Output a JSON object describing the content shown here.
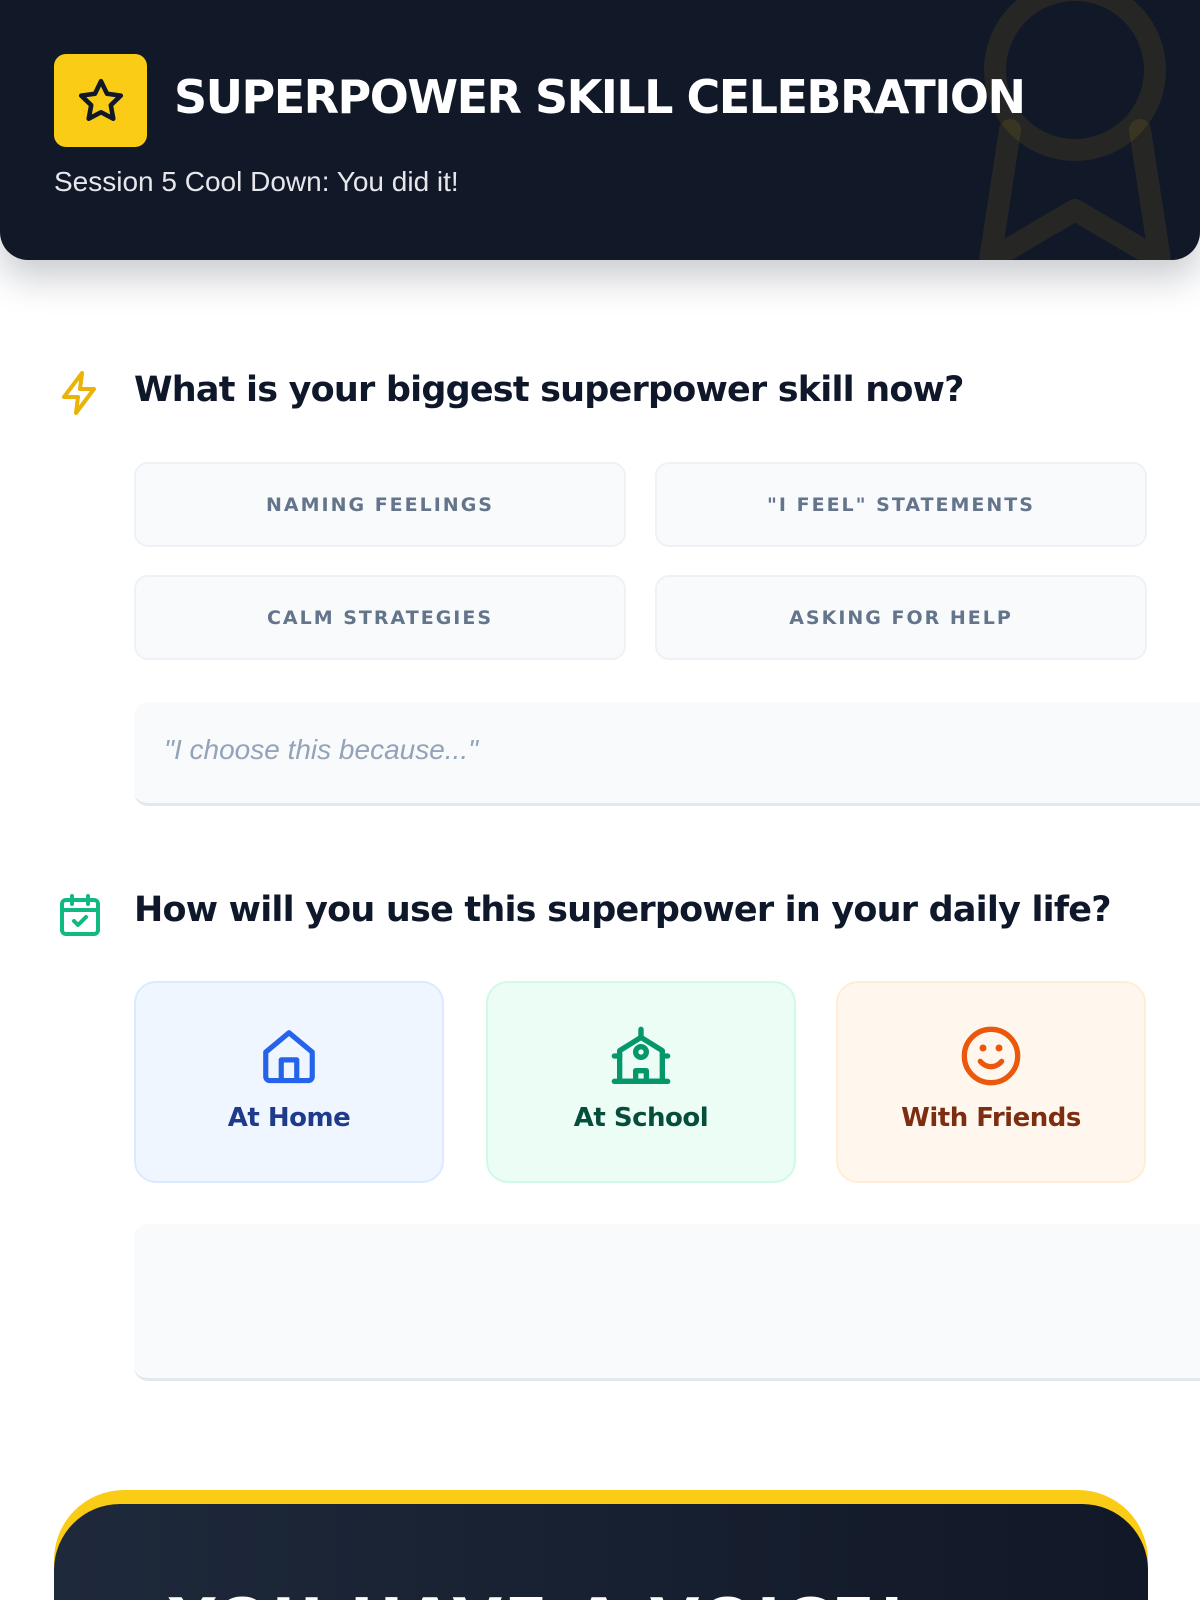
{
  "header": {
    "title": "SUPERPOWER SKILL CELEBRATION",
    "subtitle": "Session 5 Cool Down: You did it!",
    "icon": "star-icon",
    "decoration_icon": "award-ribbon-icon"
  },
  "question1": {
    "icon": "lightning-bolt-icon",
    "title": "What is your biggest superpower skill now?",
    "options": [
      "NAMING FEELINGS",
      "\"I FEEL\" STATEMENTS",
      "CALM STRATEGIES",
      "ASKING FOR HELP"
    ],
    "reason_placeholder": "\"I choose this because...\""
  },
  "question2": {
    "icon": "calendar-check-icon",
    "title": "How will you use this superpower in your daily life?",
    "cards": [
      {
        "label": "At Home",
        "icon": "house-icon",
        "color": "#2563eb",
        "text_color": "#1e3a8a"
      },
      {
        "label": "At School",
        "icon": "school-icon",
        "color": "#059669",
        "text_color": "#064e3b"
      },
      {
        "label": "With Friends",
        "icon": "smile-icon",
        "color": "#ea580c",
        "text_color": "#7c2d12"
      }
    ],
    "plan_value": ""
  },
  "banner": {
    "text": "YOU HAVE A VOICE!"
  },
  "colors": {
    "header_bg": "#111827",
    "accent_yellow": "#facc15",
    "green_accent": "#10b981"
  }
}
